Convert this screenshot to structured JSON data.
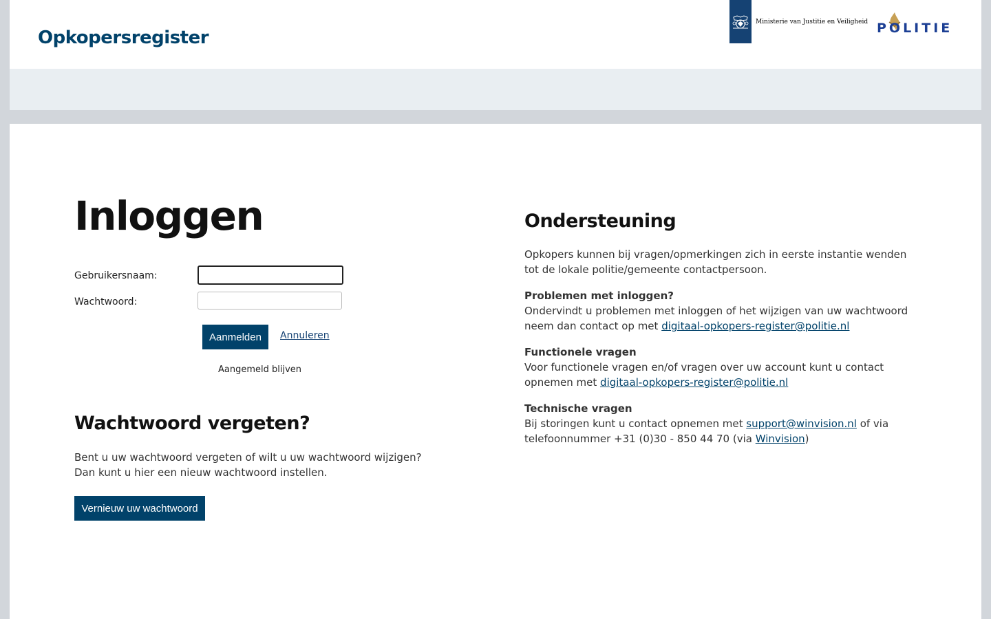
{
  "header": {
    "site_title": "Opkopersregister",
    "ministerie_logo_text": "Ministerie van Justitie en Veiligheid",
    "politie_logo_text": "POLITIE"
  },
  "colors": {
    "brand": "#01426a",
    "politie_blue": "#1c3f94",
    "politie_flame": "#c7a055",
    "ministerie_bar": "#154273"
  },
  "login": {
    "title": "Inloggen",
    "username_label": "Gebruikersnaam:",
    "username_value": "",
    "password_label": "Wachtwoord:",
    "password_value": "",
    "submit_label": "Aanmelden",
    "cancel_label": "Annuleren",
    "remember_label": "Aangemeld blijven"
  },
  "forgot": {
    "title": "Wachtwoord vergeten?",
    "line1": "Bent u uw wachtwoord vergeten of wilt u uw wachtwoord wijzigen?",
    "line2": "Dan kunt u hier een nieuw wachtwoord instellen.",
    "button_label": "Vernieuw uw wachtwoord"
  },
  "support": {
    "title": "Ondersteuning",
    "intro": "Opkopers kunnen bij vragen/opmerkingen zich in eerste instantie wenden tot de lokale politie/gemeente contactpersoon.",
    "login_problems": {
      "heading": "Problemen met inloggen?",
      "text": "Ondervindt u problemen met inloggen of het wijzigen van uw wachtwoord neem dan contact op met ",
      "email": "digitaal-opkopers-register@politie.nl"
    },
    "functional": {
      "heading": "Functionele vragen",
      "text": "Voor functionele vragen en/of vragen over uw account kunt u contact opnemen met ",
      "email": "digitaal-opkopers-register@politie.nl"
    },
    "technical": {
      "heading": "Technische vragen",
      "text_before": "Bij storingen kunt u contact opnemen met ",
      "email": "support@winvision.nl",
      "text_middle": " of via telefoonnummer +31 (0)30 - 850 44 70 (via ",
      "link": "Winvision",
      "text_after": ")"
    }
  }
}
